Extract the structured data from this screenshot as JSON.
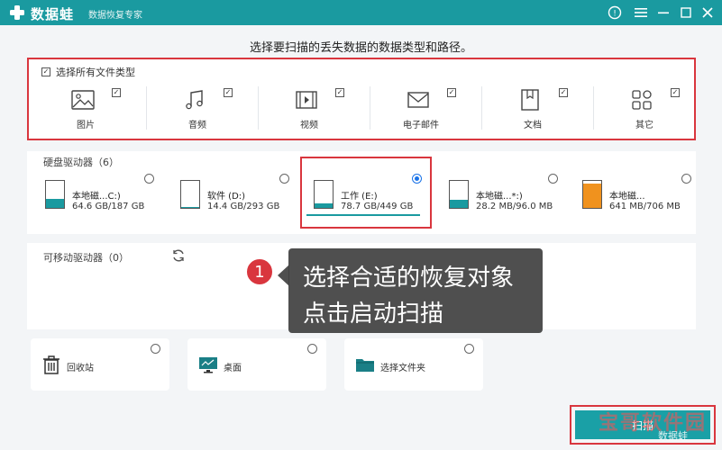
{
  "app": {
    "name": "数据蛙",
    "subtitle": "数据恢复专家"
  },
  "headline": "选择要扫描的丢失数据的数据类型和路径。",
  "file_types": {
    "select_all_label": "选择所有文件类型",
    "select_all_checked": true,
    "items": [
      {
        "label": "图片",
        "icon": "image-icon",
        "checked": true
      },
      {
        "label": "音频",
        "icon": "music-icon",
        "checked": true
      },
      {
        "label": "视频",
        "icon": "video-icon",
        "checked": true
      },
      {
        "label": "电子邮件",
        "icon": "mail-icon",
        "checked": true
      },
      {
        "label": "文档",
        "icon": "document-icon",
        "checked": true
      },
      {
        "label": "其它",
        "icon": "other-icon",
        "checked": true
      }
    ]
  },
  "hard_drives": {
    "title": "硬盘驱动器（6）",
    "items": [
      {
        "name": "本地磁...C:)",
        "size": "64.6 GB/187 GB",
        "used": 0.35,
        "color": "#1a9aa0",
        "selected": false
      },
      {
        "name": "软件 (D:)",
        "size": "14.4 GB/293 GB",
        "used": 0.05,
        "color": "#1a9aa0",
        "selected": false
      },
      {
        "name": "工作 (E:)",
        "size": "78.7 GB/449 GB",
        "used": 0.18,
        "color": "#1a9aa0",
        "selected": true
      },
      {
        "name": "本地磁...*:)",
        "size": "28.2 MB/96.0 MB",
        "used": 0.29,
        "color": "#1a9aa0",
        "selected": false
      },
      {
        "name": "本地磁...",
        "size": "641 MB/706 MB",
        "used": 0.91,
        "color": "#f0921e",
        "selected": false
      }
    ]
  },
  "removable": {
    "title": "可移动驱动器（0）"
  },
  "locations": [
    {
      "label": "回收站",
      "icon": "trash-icon"
    },
    {
      "label": "桌面",
      "icon": "desktop-icon"
    },
    {
      "label": "选择文件夹",
      "icon": "folder-icon"
    }
  ],
  "callout": {
    "step": "1",
    "line1": "选择合适的恢复对象",
    "line2": "点击启动扫描"
  },
  "scan_button_label": "扫描",
  "watermark": {
    "text": "宝哥软件园",
    "sub": "数据蛙"
  },
  "colors": {
    "accent": "#1a9aa0",
    "highlight": "#d9363e",
    "warning": "#f0921e"
  }
}
